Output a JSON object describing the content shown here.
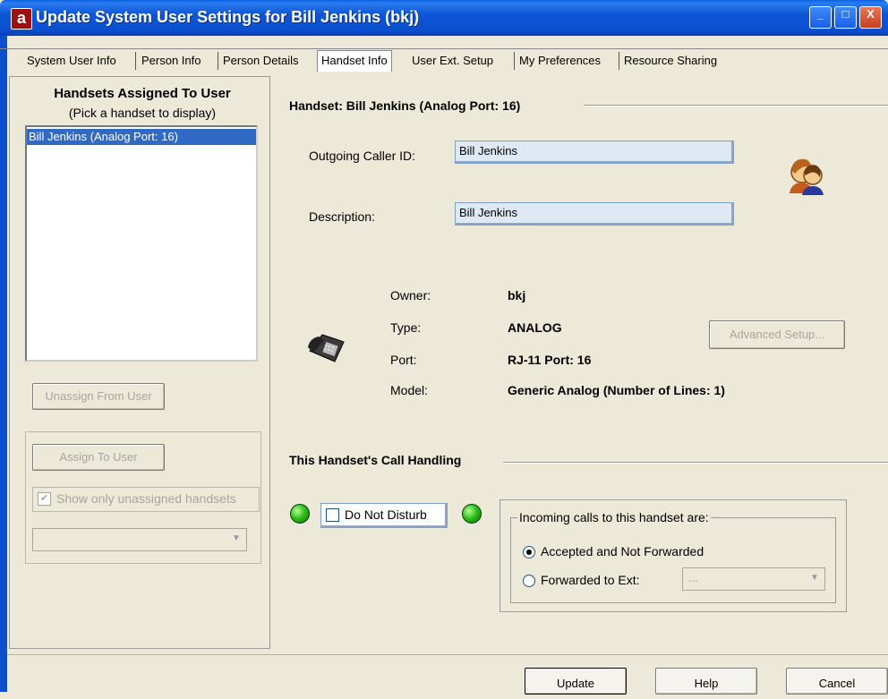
{
  "window": {
    "title": "Update System User Settings for Bill Jenkins (bkj)",
    "logo_letter": "a",
    "controls": {
      "minimize": "_",
      "maximize": "□",
      "close": "X"
    },
    "accent": "#0b4fce"
  },
  "tabs": [
    {
      "label": "System User Info"
    },
    {
      "label": "Person Info"
    },
    {
      "label": "Person Details"
    },
    {
      "label": "Handset Info",
      "active": true
    },
    {
      "label": "User Ext. Setup"
    },
    {
      "label": "My Preferences"
    },
    {
      "label": "Resource Sharing"
    }
  ],
  "left_panel": {
    "title": "Handsets Assigned To User",
    "subtitle": "(Pick a handset to display)",
    "handsets": [
      "Bill Jenkins (Analog Port: 16)"
    ],
    "unassign_label": "Unassign From User",
    "assign_label": "Assign To User",
    "show_unassigned_label": "Show only unassigned handsets",
    "show_unassigned_checked": true,
    "combo_value": ""
  },
  "handset": {
    "section_title": "Handset: Bill Jenkins (Analog Port: 16)",
    "caller_id_label": "Outgoing Caller ID:",
    "caller_id_value": "Bill Jenkins",
    "description_label": "Description:",
    "description_value": "Bill Jenkins",
    "owner_label": "Owner:",
    "owner_value": "bkj",
    "type_label": "Type:",
    "type_value": "ANALOG",
    "port_label": "Port:",
    "port_value": "RJ-11 Port: 16",
    "model_label": "Model:",
    "model_value": "Generic Analog (Number of Lines: 1)",
    "advanced_setup_label": "Advanced Setup..."
  },
  "call_handling": {
    "section_title": "This Handset's Call Handling",
    "dnd_label": "Do Not Disturb",
    "dnd_checked": false,
    "incoming_legend": "Incoming calls to this handset are:",
    "option_accepted": "Accepted and Not Forwarded",
    "option_forwarded": "Forwarded to Ext:",
    "selected_option": "accepted",
    "forward_ext_value": "..."
  },
  "footer": {
    "update_label": "Update",
    "help_label": "Help",
    "cancel_label": "Cancel"
  }
}
